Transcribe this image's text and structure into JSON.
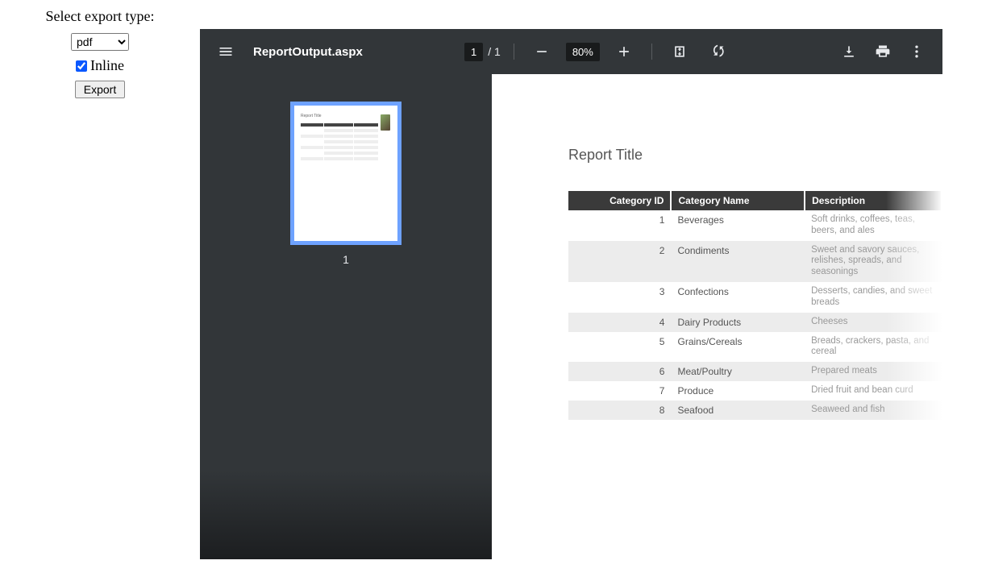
{
  "left": {
    "heading": "Select export type:",
    "select_value": "pdf",
    "inline_label": "Inline",
    "inline_checked": true,
    "export_label": "Export"
  },
  "pdf": {
    "title": "ReportOutput.aspx",
    "page_current": "1",
    "page_total": "1",
    "zoom": "80%",
    "thumb_number": "1"
  },
  "report": {
    "title": "Report Title",
    "headers": [
      "Category ID",
      "Category Name",
      "Description"
    ],
    "rows": [
      {
        "id": "1",
        "name": "Beverages",
        "desc": "Soft drinks, coffees, teas, beers, and ales"
      },
      {
        "id": "2",
        "name": "Condiments",
        "desc": "Sweet and savory sauces, relishes, spreads, and seasonings"
      },
      {
        "id": "3",
        "name": "Confections",
        "desc": "Desserts, candies, and sweet breads"
      },
      {
        "id": "4",
        "name": "Dairy Products",
        "desc": "Cheeses"
      },
      {
        "id": "5",
        "name": "Grains/Cereals",
        "desc": "Breads, crackers, pasta, and cereal"
      },
      {
        "id": "6",
        "name": "Meat/Poultry",
        "desc": "Prepared meats"
      },
      {
        "id": "7",
        "name": "Produce",
        "desc": "Dried fruit and bean curd"
      },
      {
        "id": "8",
        "name": "Seafood",
        "desc": "Seaweed and fish"
      }
    ]
  }
}
